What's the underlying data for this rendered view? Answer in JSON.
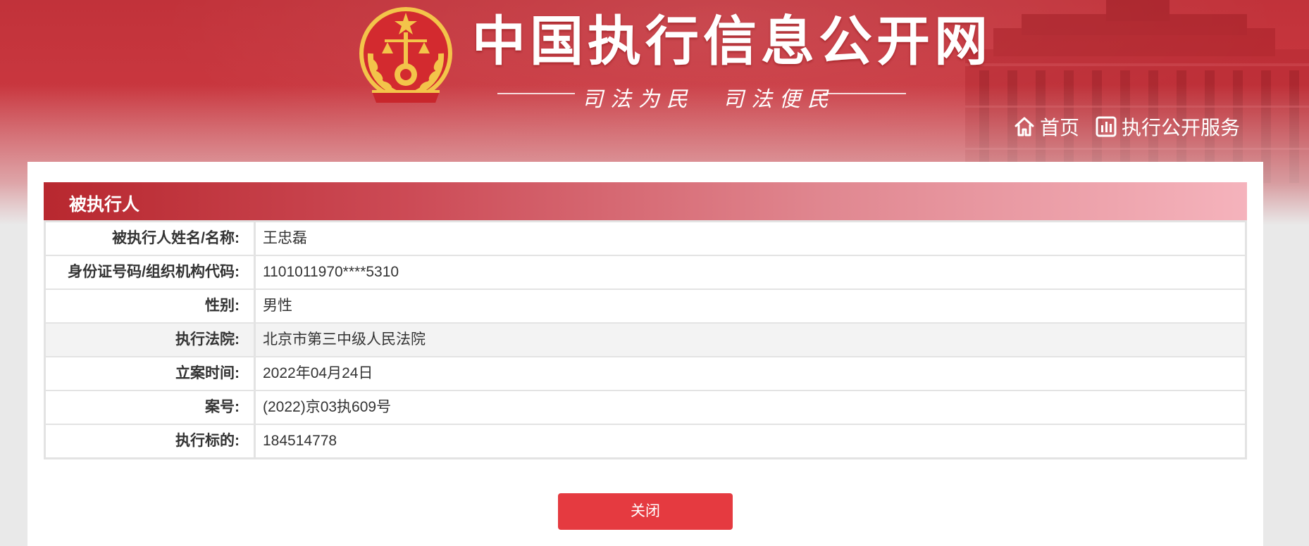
{
  "header": {
    "site_title": "中国执行信息公开网",
    "slogan": "司法为民　司法便民",
    "nav": [
      {
        "label": "首页",
        "icon": "home-icon"
      },
      {
        "label": "执行公开服务",
        "icon": "chart-icon"
      }
    ]
  },
  "section": {
    "title": "被执行人"
  },
  "record": [
    {
      "label": "被执行人姓名/名称:",
      "value": "王忠磊"
    },
    {
      "label": "身份证号码/组织机构代码:",
      "value": "1101011970****5310"
    },
    {
      "label": "性别:",
      "value": "男性"
    },
    {
      "label": "执行法院:",
      "value": "北京市第三中级人民法院"
    },
    {
      "label": "立案时间:",
      "value": "2022年04月24日"
    },
    {
      "label": "案号:",
      "value": "(2022)京03执609号"
    },
    {
      "label": "执行标的:",
      "value": "184514778"
    }
  ],
  "actions": {
    "close_label": "关闭"
  },
  "colors": {
    "brand_red": "#c1323a",
    "button_red": "#e53a40",
    "emblem_gold": "#f3c44a"
  }
}
